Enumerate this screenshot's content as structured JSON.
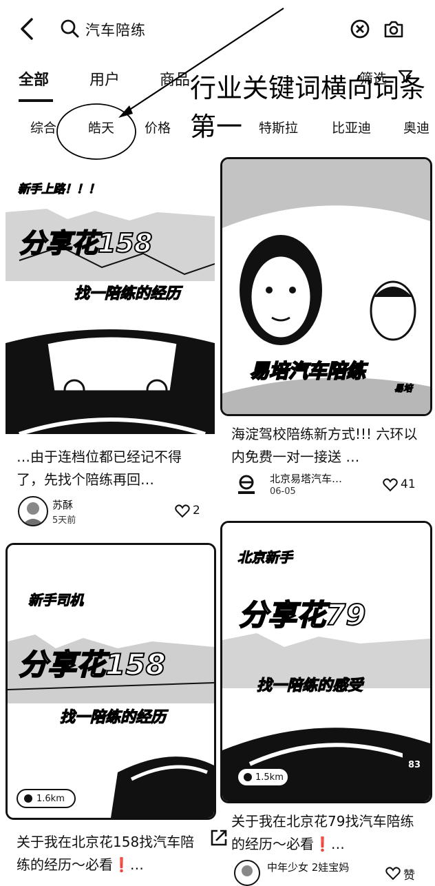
{
  "header": {
    "query": "汽车陪练"
  },
  "tabs": [
    "全部",
    "用户",
    "商品"
  ],
  "filter_label": "筛选",
  "chips": [
    "综合",
    "皓天",
    "价格",
    "特斯拉",
    "比亚迪",
    "奥迪"
  ],
  "annotation": {
    "text": "行业关键词横向词条第一"
  },
  "cards": [
    {
      "overlay_top": "新手上路！！！",
      "overlay_big": "分享花158",
      "overlay_sub": "找一陪练的经历",
      "title": "…由于连档位都已经记不得了，先找个陪练再回…",
      "author": "苏酥",
      "date": "5天前",
      "likes": "2"
    },
    {
      "overlay_caption": "易培汽车陪练",
      "overlay_corner": "易培",
      "title": "海淀驾校陪练新方式!!! 六环以内免费一对一接送 …",
      "author": "北京易塔汽车…",
      "date": "06-05",
      "likes": "41"
    },
    {
      "overlay_top": "新手司机",
      "overlay_big": "分享花158",
      "overlay_sub": "找一陪练的经历",
      "distance": "1.6km",
      "title": "关于我在北京花158找汽车陪练的经历～必看❗…"
    },
    {
      "overlay_top": "北京新手",
      "overlay_big": "分享花79",
      "overlay_sub": "找一陪练的感受",
      "distance": "1.5km",
      "speed": "83",
      "title": "关于我在北京花79找汽车陪练的经历～必看❗…",
      "author": "中年少女 2娃宝妈",
      "likes": "赞"
    }
  ]
}
